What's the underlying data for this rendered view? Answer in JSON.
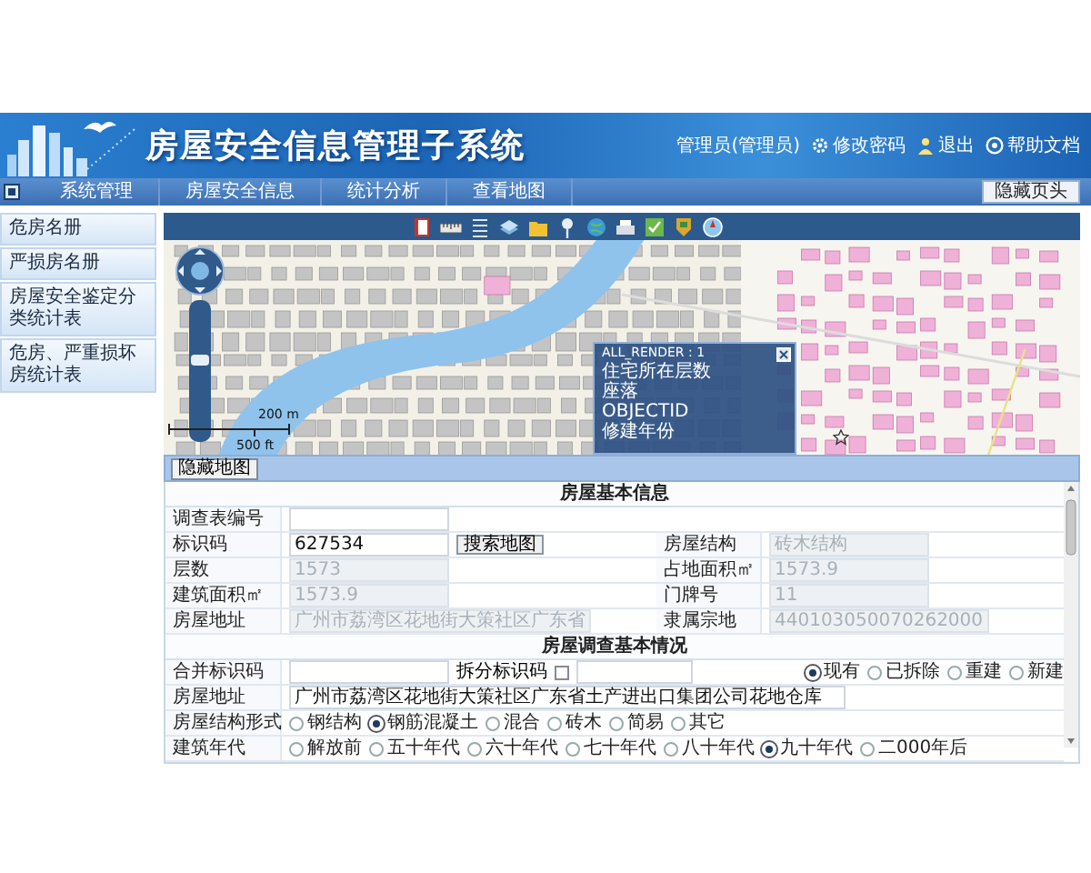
{
  "header": {
    "title": "房屋安全信息管理子系统",
    "user": "管理员(管理员)",
    "links": [
      {
        "kind": "settings",
        "label": "修改密码"
      },
      {
        "kind": "exit",
        "label": "退出"
      },
      {
        "kind": "help",
        "label": "帮助文档"
      }
    ]
  },
  "nav": {
    "items": [
      {
        "label": "系统管理",
        "selected": false
      },
      {
        "label": "房屋安全信息",
        "selected": false
      },
      {
        "label": "统计分析",
        "selected": false
      },
      {
        "label": "查看地图",
        "selected": false
      }
    ],
    "hide_header_button": "隐藏页头"
  },
  "sidebar": {
    "items": [
      {
        "label": "危房名册",
        "selected": false
      },
      {
        "label": "严损房名册",
        "selected": false
      },
      {
        "label": "房屋安全鉴定分类统计表",
        "selected": false
      },
      {
        "label": "危房、严重损坏房统计表",
        "selected": false
      }
    ]
  },
  "map": {
    "zoom_slider": {
      "level": 0.6
    },
    "scale": [
      "200 m",
      "500 ft"
    ],
    "popup": {
      "lines": [
        "ALL_RENDER : 1",
        "住宅所在层数",
        "座落",
        "OBJECTID",
        "修建年份"
      ]
    },
    "hide_map_button": "隐藏地图"
  },
  "basic_info": {
    "title": "房屋基本信息",
    "rows": [
      {
        "label": "调查表编号",
        "field": {
          "disabled": false
        }
      },
      {
        "label": "标识码",
        "field": {
          "value": "627534",
          "disabled": false
        },
        "button": "搜索地图",
        "label_2": "房屋结构",
        "field_2": {
          "value": "砖木结构",
          "disabled": true
        }
      },
      {
        "label": "层数",
        "field": {
          "value": "1573",
          "disabled": true
        },
        "label_2": "占地面积㎡",
        "field_2": {
          "value": "1573.9",
          "disabled": true
        }
      },
      {
        "label": "建筑面积㎡",
        "field": {
          "value": "1573.9",
          "disabled": true
        },
        "label_2": "门牌号",
        "field_2": {
          "value": "11",
          "disabled": true
        }
      },
      {
        "label": "房屋地址",
        "field": {
          "value": "广州市荔湾区花地街大策社区广东省",
          "disabled": true
        },
        "label_2": "隶属宗地",
        "field_2": {
          "value": "440103050070262000",
          "disabled": true
        }
      }
    ]
  },
  "survey": {
    "title": "房屋调查基本情况",
    "rows": [
      {
        "label": "合并标识码",
        "items": [
          {
            "kind": "field",
            "disabled": false
          },
          {
            "kind": "text",
            "text": "拆分标识码"
          },
          {
            "kind": "checkbox",
            "checked": false
          },
          {
            "kind": "field",
            "disabled": false
          },
          {
            "kind": "radio",
            "label": "现有",
            "selected": true
          },
          {
            "kind": "radio",
            "label": "已拆除",
            "selected": false
          },
          {
            "kind": "radio",
            "label": "重建",
            "selected": false
          },
          {
            "kind": "radio",
            "label": "新建",
            "selected": false
          }
        ]
      },
      {
        "label": "房屋地址",
        "items": [
          {
            "kind": "field",
            "value": "广州市荔湾区花地街大策社区广东省土产进出口集团公司花地仓库",
            "disabled": false
          }
        ]
      },
      {
        "label": "房屋结构形式",
        "items": [
          {
            "kind": "radio",
            "label": "钢结构",
            "selected": false
          },
          {
            "kind": "radio",
            "label": "钢筋混凝土",
            "selected": true
          },
          {
            "kind": "radio",
            "label": "混合",
            "selected": false
          },
          {
            "kind": "radio",
            "label": "砖木",
            "selected": false
          },
          {
            "kind": "radio",
            "label": "简易",
            "selected": false
          },
          {
            "kind": "radio",
            "label": "其它",
            "selected": false
          }
        ]
      },
      {
        "label": "建筑年代",
        "items": [
          {
            "kind": "radio",
            "label": "解放前",
            "selected": false
          },
          {
            "kind": "radio",
            "label": "五十年代",
            "selected": false
          },
          {
            "kind": "radio",
            "label": "六十年代",
            "selected": false
          },
          {
            "kind": "radio",
            "label": "七十年代",
            "selected": false
          },
          {
            "kind": "radio",
            "label": "八十年代",
            "selected": false
          },
          {
            "kind": "radio",
            "label": "九十年代",
            "selected": true
          },
          {
            "kind": "radio",
            "label": "二000年后",
            "selected": false
          }
        ]
      }
    ]
  }
}
